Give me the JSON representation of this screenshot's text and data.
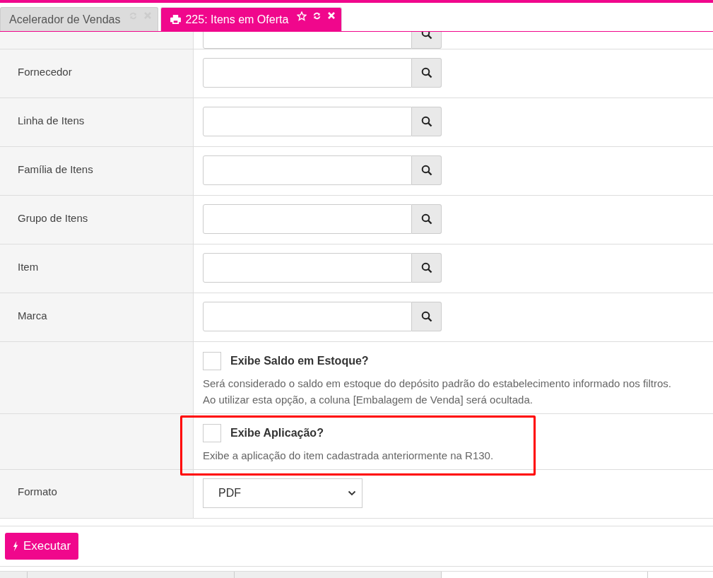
{
  "tabs": [
    {
      "label": "Acelerador de Vendas",
      "selected": false
    },
    {
      "label": "225: Itens em Oferta",
      "selected": true
    }
  ],
  "form": {
    "rows": [
      {
        "kind": "lookup",
        "partial": true
      },
      {
        "kind": "lookup",
        "label": "Fornecedor",
        "partial": false
      },
      {
        "kind": "lookup",
        "label": "Linha de Itens",
        "partial": false
      },
      {
        "kind": "lookup",
        "label": "Família de Itens",
        "partial": false
      },
      {
        "kind": "lookup",
        "label": "Grupo de Itens",
        "partial": false
      },
      {
        "kind": "lookup",
        "label": "Item",
        "partial": false
      },
      {
        "kind": "lookup",
        "label": "Marca",
        "partial": false
      },
      {
        "kind": "checkbox",
        "title": "Exibe Saldo em Estoque?",
        "checked": false,
        "highlighted": false,
        "help": [
          "Será considerado o saldo em estoque do depósito padrão do estabelecimento informado nos filtros.",
          "Ao utilizar esta opção, a coluna [Embalagem de Venda] será ocultada."
        ]
      },
      {
        "kind": "checkbox",
        "title": "Exibe Aplicação?",
        "checked": false,
        "highlighted": true,
        "help": [
          "Exibe a aplicação do item cadastrada anteriormente na R130."
        ]
      },
      {
        "kind": "select",
        "label": "Formato",
        "value": "PDF"
      }
    ]
  },
  "actions": [
    {
      "label": "Executar"
    }
  ]
}
